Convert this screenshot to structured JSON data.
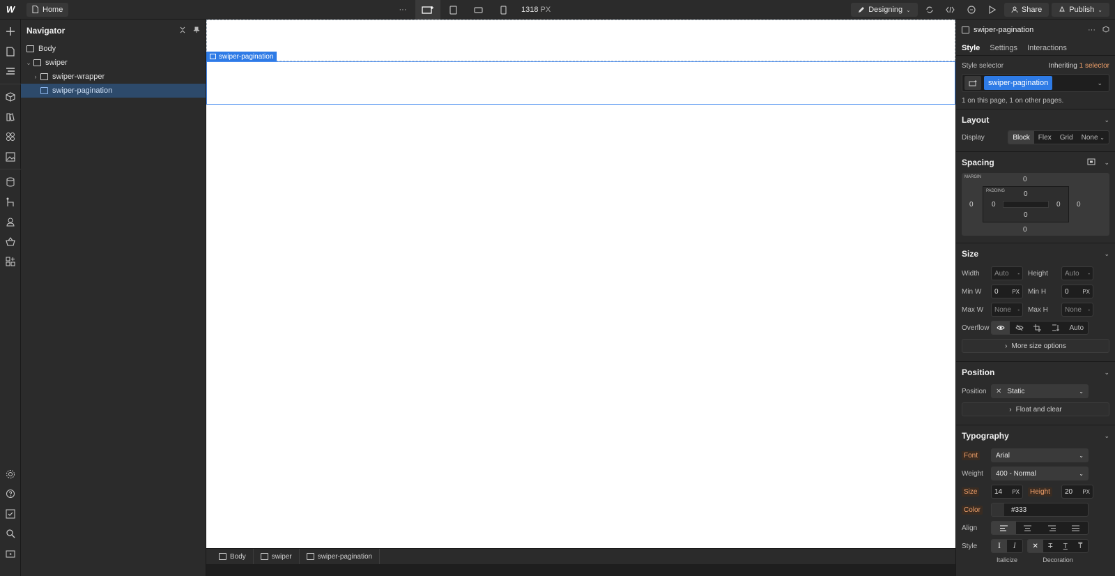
{
  "topbar": {
    "logo": "W",
    "home_label": "Home",
    "more": "···",
    "viewport_px": "1318",
    "px_unit": "PX",
    "mode_label": "Designing",
    "share_label": "Share",
    "publish_label": "Publish"
  },
  "navigator": {
    "title": "Navigator",
    "items": [
      {
        "label": "Body"
      },
      {
        "label": "swiper"
      },
      {
        "label": "swiper-wrapper"
      },
      {
        "label": "swiper-pagination"
      }
    ]
  },
  "canvas": {
    "selected_tag": "swiper-pagination"
  },
  "breadcrumbs": [
    "Body",
    "swiper",
    "swiper-pagination"
  ],
  "panel": {
    "element_name": "swiper-pagination",
    "tabs": [
      "Style",
      "Settings",
      "Interactions"
    ],
    "style_selector_label": "Style selector",
    "inheriting_label": "Inheriting",
    "inheriting_count": "1 selector",
    "selector_chip": "swiper-pagination",
    "usage_note": "1 on this page, 1 on other pages.",
    "layout": {
      "title": "Layout",
      "display_label": "Display",
      "options": [
        "Block",
        "Flex",
        "Grid",
        "None"
      ]
    },
    "spacing": {
      "title": "Spacing",
      "margin_label": "MARGIN",
      "padding_label": "PADDING",
      "margin": {
        "top": "0",
        "right": "0",
        "bottom": "0",
        "left": "0"
      },
      "padding": {
        "top": "0",
        "right": "0",
        "bottom": "0",
        "left": "0"
      }
    },
    "size": {
      "title": "Size",
      "width_label": "Width",
      "width_value": "Auto",
      "height_label": "Height",
      "height_value": "Auto",
      "minw_label": "Min W",
      "minw_value": "0",
      "minh_label": "Min H",
      "minh_value": "0",
      "maxw_label": "Max W",
      "maxw_value": "None",
      "maxh_label": "Max H",
      "maxh_value": "None",
      "unit": "PX",
      "overflow_label": "Overflow",
      "overflow_auto": "Auto",
      "more_label": "More size options"
    },
    "position": {
      "title": "Position",
      "label": "Position",
      "value": "Static",
      "float_label": "Float and clear"
    },
    "typography": {
      "title": "Typography",
      "font_label": "Font",
      "font_value": "Arial",
      "weight_label": "Weight",
      "weight_value": "400 - Normal",
      "size_label": "Size",
      "size_value": "14",
      "height_label": "Height",
      "height_value": "20",
      "unit": "PX",
      "color_label": "Color",
      "color_value": "#333",
      "align_label": "Align",
      "style_label": "Style",
      "italicize_label": "Italicize",
      "decoration_label": "Decoration"
    }
  },
  "colors": {
    "accent": "#2e7be6",
    "panel_bg": "#2b2b2b",
    "canvas_bg": "#ffffff"
  }
}
